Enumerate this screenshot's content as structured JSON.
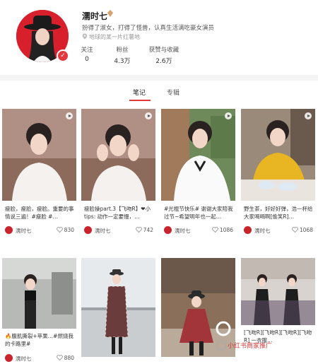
{
  "profile": {
    "name": "濡时七",
    "bio": "扮得了淑女，打得了怪兽，认真生活满吃豪女演员",
    "location": "地球的某一片红薯地",
    "stats": [
      {
        "label": "关注",
        "value": "0"
      },
      {
        "label": "粉丝",
        "value": "4.3万"
      },
      {
        "label": "获赞与收藏",
        "value": "2.6万"
      }
    ]
  },
  "tabs": [
    {
      "label": "笔记",
      "active": true
    },
    {
      "label": "专辑",
      "active": false
    }
  ],
  "notes": [
    {
      "caption": "瘦脸，瘦脸，瘦脸。重要的事情说三遍！#瘦脸 #…",
      "author": "濡时七",
      "likes": "830",
      "video": true
    },
    {
      "caption": "瘦脸操part.3【飞吻R】❤小tips: 动作一定要慢，…",
      "author": "濡时七",
      "likes": "742",
      "video": true
    },
    {
      "caption": "#光棍节快乐# 谢谢大家陪我过节~希望明年也一起…",
      "author": "濡时七",
      "likes": "1086",
      "video": true
    },
    {
      "caption": "野生茶，好好好弹，浩一杯给大家喝喝啊[偷笑R]…",
      "author": "濡时七",
      "likes": "1068",
      "video": true
    },
    {
      "caption": "🔥腹肌撕裂+苹果…#燃烧我的卡路里#",
      "author": "濡时七",
      "likes": "880",
      "video": false
    },
    {
      "caption": "",
      "author": "",
      "likes": "",
      "video": false
    },
    {
      "caption": "",
      "author": "",
      "likes": "",
      "video": false
    },
    {
      "caption": "[飞吻R][飞吻R][飞吻R][飞吻R] 一衣服…",
      "author": "",
      "likes": "",
      "video": false
    }
  ],
  "watermark": "小红书商家推广",
  "colors": {
    "accent": "#e4393c",
    "avatar_bg": "#d8202c"
  }
}
